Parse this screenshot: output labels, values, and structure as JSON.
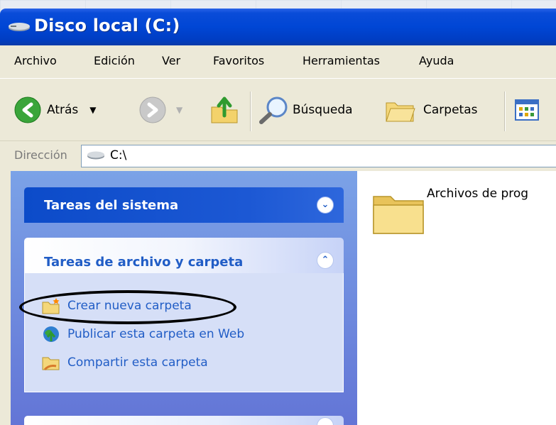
{
  "window": {
    "title": "Disco local (C:)",
    "title_icon": "hard-drive-icon"
  },
  "menubar": {
    "items": [
      "Archivo",
      "Edición",
      "Ver",
      "Favoritos",
      "Herramientas",
      "Ayuda"
    ]
  },
  "toolbar": {
    "back_label": "Atrás",
    "back_icon": "back-arrow-icon",
    "forward_icon": "forward-arrow-icon",
    "up_icon": "folder-up-icon",
    "search_label": "Búsqueda",
    "search_icon": "magnifier-icon",
    "folders_label": "Carpetas",
    "folders_icon": "folders-icon",
    "views_icon": "views-icon"
  },
  "addressbar": {
    "label": "Dirección",
    "value": "C:\\",
    "icon": "hard-drive-icon"
  },
  "taskpane": {
    "system_tasks": {
      "title": "Tareas del sistema",
      "collapsed": true
    },
    "file_folder_tasks": {
      "title": "Tareas de archivo y carpeta",
      "expanded": true,
      "items": [
        {
          "label": "Crear nueva carpeta",
          "icon": "new-folder-icon",
          "highlighted": true
        },
        {
          "label": "Publicar esta carpeta en Web",
          "icon": "publish-web-icon"
        },
        {
          "label": "Compartir esta carpeta",
          "icon": "share-folder-icon"
        }
      ]
    }
  },
  "content": {
    "items": [
      {
        "label": "Archivos de prog",
        "icon": "folder-icon"
      }
    ]
  },
  "colors": {
    "titlebar": "#0046d5",
    "taskpane": "#7ba2e7",
    "link": "#215dc6",
    "chrome": "#ece9d8"
  }
}
